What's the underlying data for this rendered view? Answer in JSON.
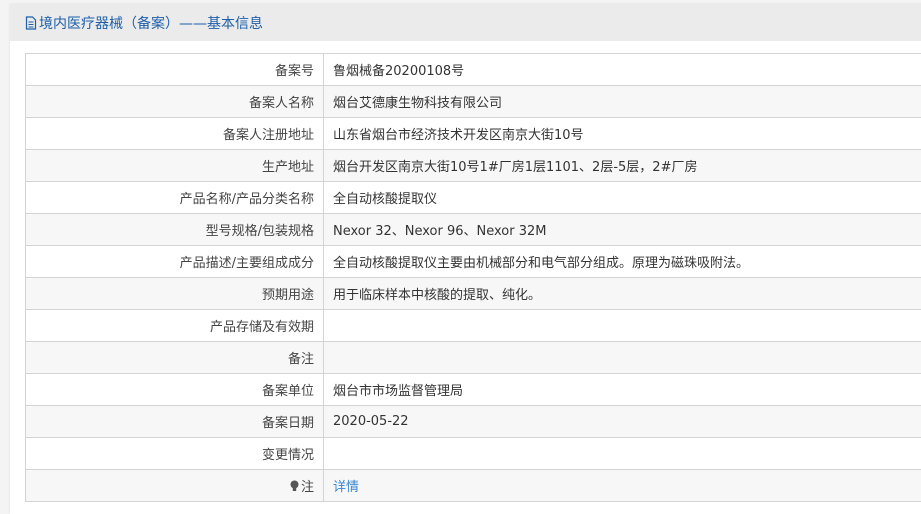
{
  "header": {
    "title": "境内医疗器械（备案）——基本信息"
  },
  "rows": [
    {
      "label": "备案号",
      "value": "鲁烟械备20200108号"
    },
    {
      "label": "备案人名称",
      "value": "烟台艾德康生物科技有限公司"
    },
    {
      "label": "备案人注册地址",
      "value": "山东省烟台市经济技术开发区南京大街10号"
    },
    {
      "label": "生产地址",
      "value": "烟台开发区南京大街10号1#厂房1层1101、2层-5层，2#厂房"
    },
    {
      "label": "产品名称/产品分类名称",
      "value": "全自动核酸提取仪"
    },
    {
      "label": "型号规格/包装规格",
      "value": "Nexor 32、Nexor 96、Nexor 32M"
    },
    {
      "label": "产品描述/主要组成成分",
      "value": "全自动核酸提取仪主要由机械部分和电气部分组成。原理为磁珠吸附法。"
    },
    {
      "label": "预期用途",
      "value": "用于临床样本中核酸的提取、纯化。"
    },
    {
      "label": "产品存储及有效期",
      "value": ""
    },
    {
      "label": "备注",
      "value": ""
    },
    {
      "label": "备案单位",
      "value": "烟台市市场监督管理局"
    },
    {
      "label": "备案日期",
      "value": "2020-05-22"
    },
    {
      "label": "变更情况",
      "value": ""
    }
  ],
  "note": {
    "label": "注",
    "link": "详情"
  }
}
